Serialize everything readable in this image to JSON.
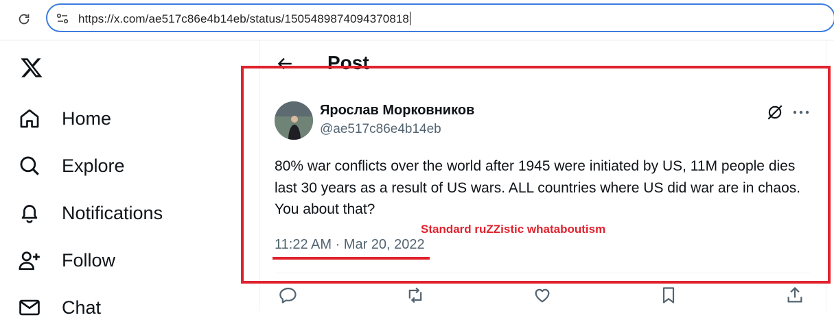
{
  "browser": {
    "url": "https://x.com/ae517c86e4b14eb/status/1505489874094370818"
  },
  "sidebar": {
    "items": [
      {
        "label": "Home",
        "icon": "home-icon"
      },
      {
        "label": "Explore",
        "icon": "search-icon"
      },
      {
        "label": "Notifications",
        "icon": "bell-icon"
      },
      {
        "label": "Follow",
        "icon": "follow-icon"
      },
      {
        "label": "Chat",
        "icon": "mail-icon"
      }
    ]
  },
  "header": {
    "title": "Post"
  },
  "post": {
    "author_name": "Ярослав Морковников",
    "author_handle": "@ae517c86e4b14eb",
    "text": "80% war conflicts over the world after 1945 were initiated by US, 11M people dies last 30 years as a result of US wars. ALL countries where US did war are in chaos. You about that?",
    "timestamp": "11:22 AM · Mar 20, 2022"
  },
  "annotation": {
    "text": "Standard ruZZistic whataboutism",
    "color": "#e0222d"
  },
  "colors": {
    "accent_url_border": "#3c7be0",
    "text_primary": "#0f1419",
    "text_secondary": "#536471"
  }
}
